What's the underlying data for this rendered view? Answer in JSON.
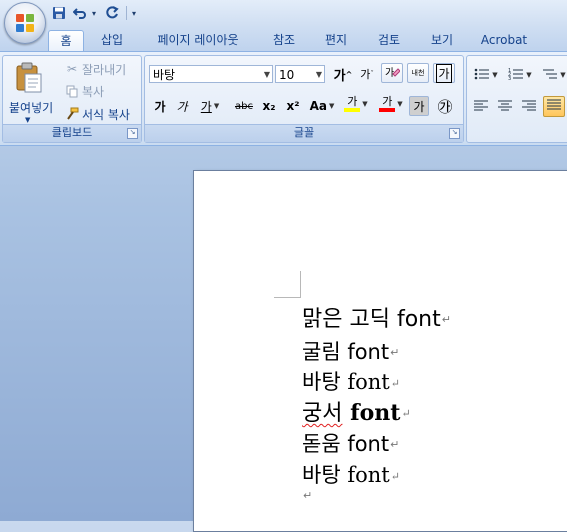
{
  "quick_access": {
    "save_icon": "save-icon",
    "undo_icon": "undo-icon",
    "redo_icon": "redo-icon",
    "customize_icon": "customize-qat-icon"
  },
  "tabs": [
    {
      "label": "홈",
      "active": true
    },
    {
      "label": "삽입"
    },
    {
      "label": "페이지 레이아웃"
    },
    {
      "label": "참조"
    },
    {
      "label": "편지"
    },
    {
      "label": "검토"
    },
    {
      "label": "보기"
    },
    {
      "label": "Acrobat"
    }
  ],
  "clipboard": {
    "group_label": "클립보드",
    "paste_label": "붙여넣기",
    "cut_label": "잘라내기",
    "copy_label": "복사",
    "format_painter_label": "서식 복사"
  },
  "font": {
    "group_label": "글꼴",
    "font_name": "바탕",
    "font_size": "10",
    "grow_font": "가",
    "shrink_font": "가",
    "bold": "가",
    "italic": "가",
    "underline": "가",
    "strikethrough": "abc",
    "subscript": "x₂",
    "superscript": "x²",
    "change_case": "Aa",
    "highlight_letter": "가",
    "font_color_letter": "가",
    "char_shading": "가",
    "enclose_char": "㉮",
    "phonetic": "내천",
    "char_border": "가",
    "clear_format": "가",
    "highlight_color": "#ffff00",
    "font_color": "#ff0000"
  },
  "document": {
    "lines": [
      {
        "text": "맑은 고딕 font"
      },
      {
        "text": "굴림 font"
      },
      {
        "text": "바탕 font"
      },
      {
        "text_ko": "궁서",
        "text_en": " font"
      },
      {
        "text": "돋움 font"
      },
      {
        "text": "바탕 font"
      }
    ],
    "paragraph_mark": "↵"
  }
}
